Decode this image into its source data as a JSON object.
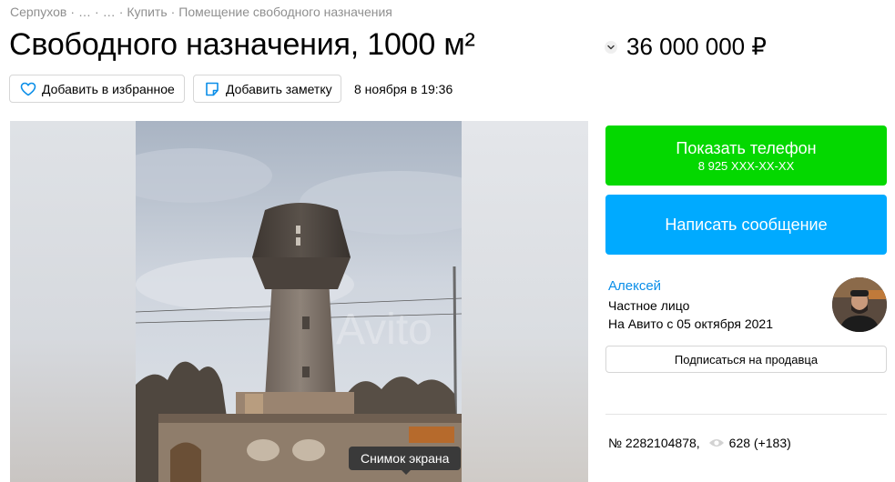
{
  "breadcrumb": {
    "items": [
      "Серпухов",
      "…",
      "…",
      "Купить",
      "Помещение свободного назначения"
    ],
    "separator": "·"
  },
  "title": "Свободного назначения, 1000 м²",
  "price": "36 000 000 ₽",
  "actions": {
    "favorite_label": "Добавить в избранное",
    "note_label": "Добавить заметку",
    "date": "8 ноября в 19:36"
  },
  "gallery": {
    "tooltip": "Снимок экрана",
    "watermark": "Avito"
  },
  "contact": {
    "phone_label": "Показать телефон",
    "phone_masked": "8 925 XXX-XX-XX",
    "message_label": "Написать сообщение"
  },
  "seller": {
    "name": "Алексей",
    "type": "Частное лицо",
    "since": "На Авито с 05 октября 2021",
    "subscribe_label": "Подписаться на продавца"
  },
  "stats": {
    "listing_number": "№ 2282104878,",
    "views": "628 (+183)"
  },
  "colors": {
    "green": "#04d800",
    "blue": "#00aaff",
    "link": "#0a8ee8",
    "muted": "#8f8f8f"
  },
  "icons": [
    "heart-icon",
    "note-icon",
    "chevron-down-icon",
    "eye-icon"
  ]
}
